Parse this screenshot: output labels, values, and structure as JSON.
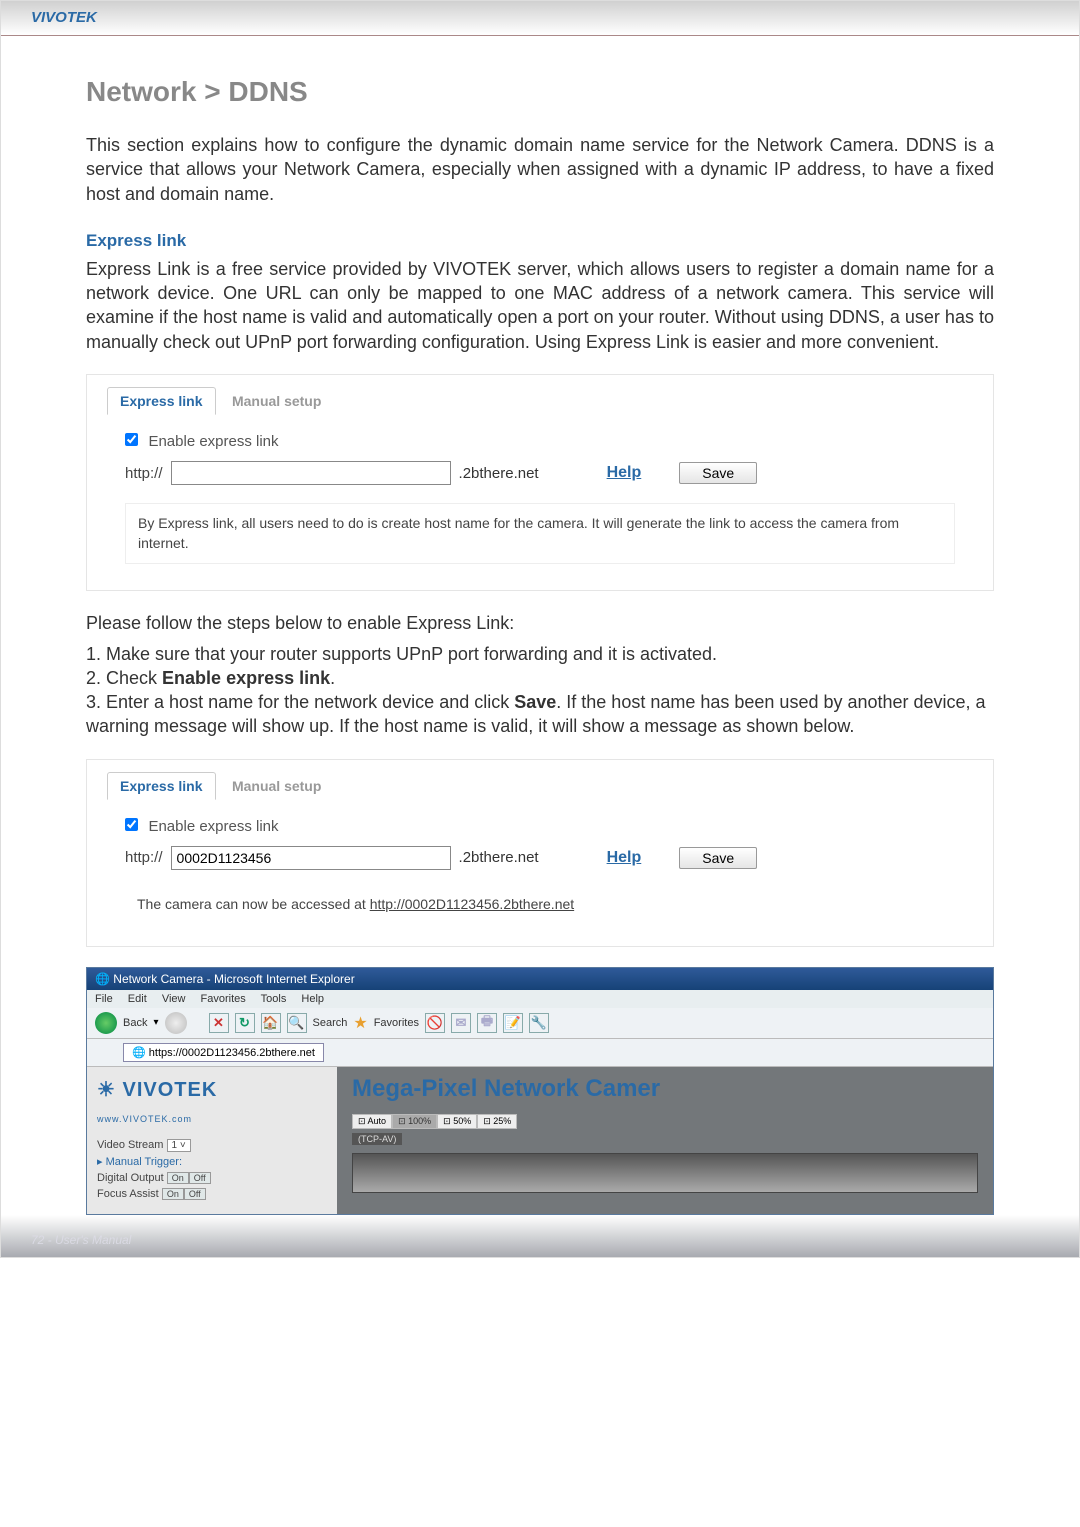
{
  "header": {
    "brand": "VIVOTEK"
  },
  "title": "Network > DDNS",
  "intro": "This section explains how to configure the dynamic domain name service for the Network Camera. DDNS is a service that allows your Network Camera, especially when assigned with a dynamic IP address, to have a fixed host and domain name.",
  "express": {
    "heading": "Express link",
    "desc": "Express Link is a free service provided by VIVOTEK server, which allows users to register a domain name for a network device. One URL can only be mapped to one MAC address of a network camera. This service will examine if the host name is valid and automatically open a port on your router. Without using DDNS, a user has to manually check out UPnP port forwarding configuration. Using Express Link is easier and more convenient."
  },
  "tabs": {
    "express": "Express link",
    "manual": "Manual setup"
  },
  "panel1": {
    "enable_label": "Enable express link",
    "url_prefix": "http://",
    "host_value": "",
    "url_suffix": ".2bthere.net",
    "help": "Help",
    "save": "Save",
    "notice": "By Express link, all users need to do is create host name for the camera. It will generate the link to access the camera from internet."
  },
  "steps": {
    "lead": "Please follow the steps below to enable Express Link:",
    "s1": "1. Make sure that your router supports UPnP port forwarding and it is activated.",
    "s2a": "2. Check ",
    "s2b": "Enable express link",
    "s2c": ".",
    "s3a": "3. Enter a host name for the network device and click ",
    "s3b": "Save",
    "s3c": ". If the host name has been used by another device, a warning message will show up. If the host name is valid, it will show a message as shown below."
  },
  "panel2": {
    "enable_label": "Enable express link",
    "url_prefix": "http://",
    "host_value": "0002D1123456",
    "url_suffix": ".2bthere.net",
    "help": "Help",
    "save": "Save",
    "success_pre": "The camera can now be accessed at ",
    "success_link": "http://0002D1123456.2bthere.net"
  },
  "ie": {
    "title": "Network Camera - Microsoft Internet Explorer",
    "menu": {
      "file": "File",
      "edit": "Edit",
      "view": "View",
      "fav": "Favorites",
      "tools": "Tools",
      "help": "Help"
    },
    "toolbar": {
      "back": "Back",
      "search": "Search",
      "favorites": "Favorites"
    },
    "address": "https://0002D1123456.2bthere.net",
    "logo": "VIVOTEK",
    "logo_sub": "www.VIVOTEK.com",
    "mp_title": "Mega-Pixel Network Camer",
    "video_stream_label": "Video Stream",
    "video_stream_value": "1",
    "manual_trigger": "Manual Trigger:",
    "digital_output": "Digital Output",
    "focus_assist": "Focus Assist",
    "on": "On",
    "off": "Off",
    "zoom": {
      "auto": "Auto",
      "z100": "100%",
      "z50": "50%",
      "z25": "25%"
    },
    "protocol": "(TCP-AV)"
  },
  "footer": {
    "page": "72 - User's Manual"
  }
}
